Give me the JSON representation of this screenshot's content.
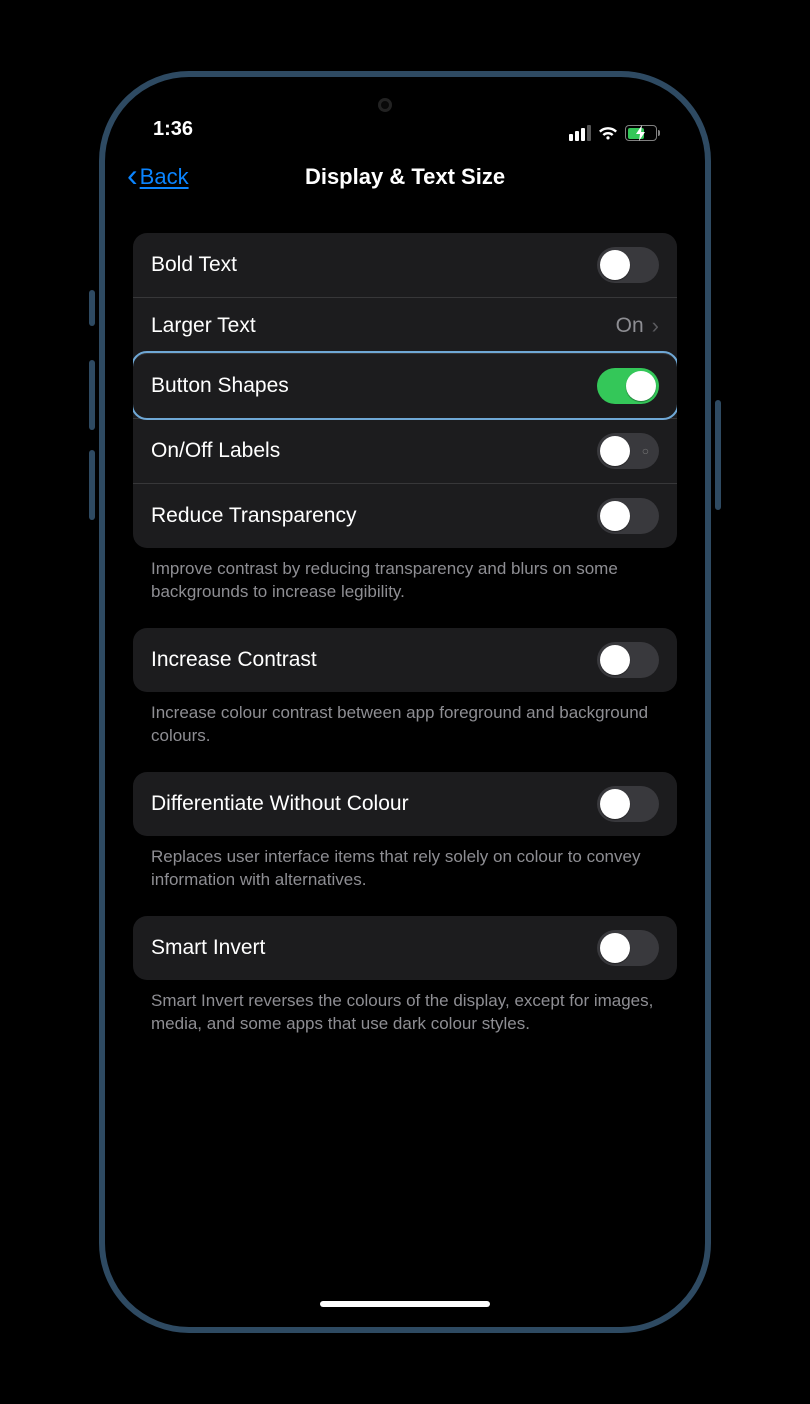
{
  "status": {
    "time": "1:36"
  },
  "nav": {
    "back_label": "Back",
    "title": "Display & Text Size"
  },
  "group1": {
    "bold_text": "Bold Text",
    "larger_text": "Larger Text",
    "larger_text_value": "On",
    "button_shapes": "Button Shapes",
    "onoff_labels": "On/Off Labels",
    "reduce_transparency": "Reduce Transparency",
    "footer": "Improve contrast by reducing transparency and blurs on some backgrounds to increase legibility."
  },
  "group2": {
    "increase_contrast": "Increase Contrast",
    "footer": "Increase colour contrast between app foreground and background colours."
  },
  "group3": {
    "differentiate": "Differentiate Without Colour",
    "footer": "Replaces user interface items that rely solely on colour to convey information with alternatives."
  },
  "group4": {
    "smart_invert": "Smart Invert",
    "footer": "Smart Invert reverses the colours of the display, except for images, media, and some apps that use dark colour styles."
  },
  "toggles": {
    "bold_text": false,
    "button_shapes": true,
    "onoff_labels": false,
    "reduce_transparency": false,
    "increase_contrast": false,
    "differentiate": false,
    "smart_invert": false
  }
}
